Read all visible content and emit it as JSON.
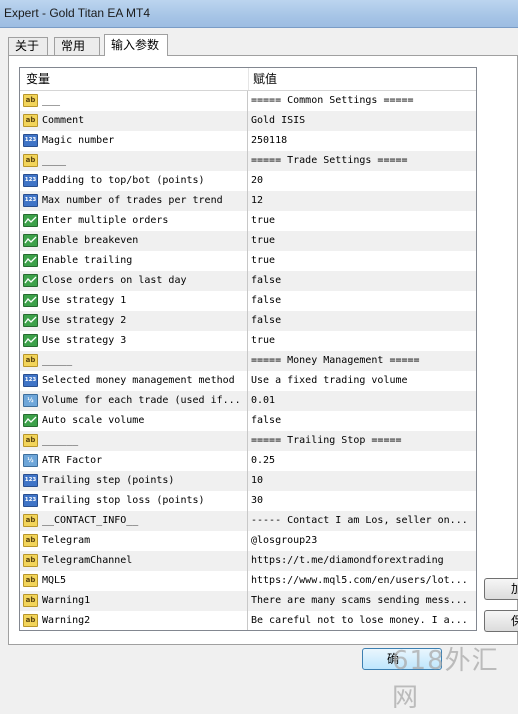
{
  "window": {
    "title": "Expert - Gold Titan EA MT4"
  },
  "tabs": [
    {
      "label": "关于"
    },
    {
      "label": "常用"
    },
    {
      "label": "输入参数"
    }
  ],
  "table": {
    "col_variable": "变量",
    "col_value": "赋值",
    "rows": [
      {
        "icon": "ab",
        "name": "___",
        "value": "===== Common Settings ====="
      },
      {
        "icon": "ab",
        "name": "Comment",
        "value": "Gold ISIS"
      },
      {
        "icon": "123",
        "name": "Magic number",
        "value": "250118"
      },
      {
        "icon": "ab",
        "name": "____",
        "value": "===== Trade Settings ====="
      },
      {
        "icon": "123",
        "name": "Padding to top/bot (points)",
        "value": "20"
      },
      {
        "icon": "123",
        "name": "Max number of trades per trend",
        "value": "12"
      },
      {
        "icon": "bool",
        "name": "Enter multiple orders",
        "value": "true"
      },
      {
        "icon": "bool",
        "name": "Enable breakeven",
        "value": "true"
      },
      {
        "icon": "bool",
        "name": "Enable trailing",
        "value": "true"
      },
      {
        "icon": "bool",
        "name": "Close orders on last day",
        "value": "false"
      },
      {
        "icon": "bool",
        "name": "Use strategy 1",
        "value": "false"
      },
      {
        "icon": "bool",
        "name": "Use strategy 2",
        "value": "false"
      },
      {
        "icon": "bool",
        "name": "Use strategy 3",
        "value": "true"
      },
      {
        "icon": "ab",
        "name": "_____",
        "value": "===== Money Management ====="
      },
      {
        "icon": "123",
        "name": "Selected money management method",
        "value": "Use a fixed trading volume"
      },
      {
        "icon": "v2",
        "name": "Volume for each trade (used if...",
        "value": "0.01"
      },
      {
        "icon": "bool",
        "name": "Auto scale volume",
        "value": "false"
      },
      {
        "icon": "ab",
        "name": "______",
        "value": "===== Trailing Stop ====="
      },
      {
        "icon": "v2",
        "name": "ATR Factor",
        "value": "0.25"
      },
      {
        "icon": "123",
        "name": "Trailing step (points)",
        "value": "10"
      },
      {
        "icon": "123",
        "name": "Trailing stop loss (points)",
        "value": "30"
      },
      {
        "icon": "ab",
        "name": "__CONTACT_INFO__",
        "value": "----- Contact I am Los, seller on..."
      },
      {
        "icon": "ab",
        "name": "Telegram",
        "value": "@losgroup23"
      },
      {
        "icon": "ab",
        "name": "TelegramChannel",
        "value": "https://t.me/diamondforextrading"
      },
      {
        "icon": "ab",
        "name": "MQL5",
        "value": "https://www.mql5.com/en/users/lot..."
      },
      {
        "icon": "ab",
        "name": "Warning1",
        "value": "There are many scams sending mess..."
      },
      {
        "icon": "ab",
        "name": "Warning2",
        "value": "Be careful not to lose money. I a..."
      }
    ]
  },
  "buttons": {
    "load": "加",
    "save": "保",
    "ok": "确"
  },
  "watermark": "618外汇网"
}
